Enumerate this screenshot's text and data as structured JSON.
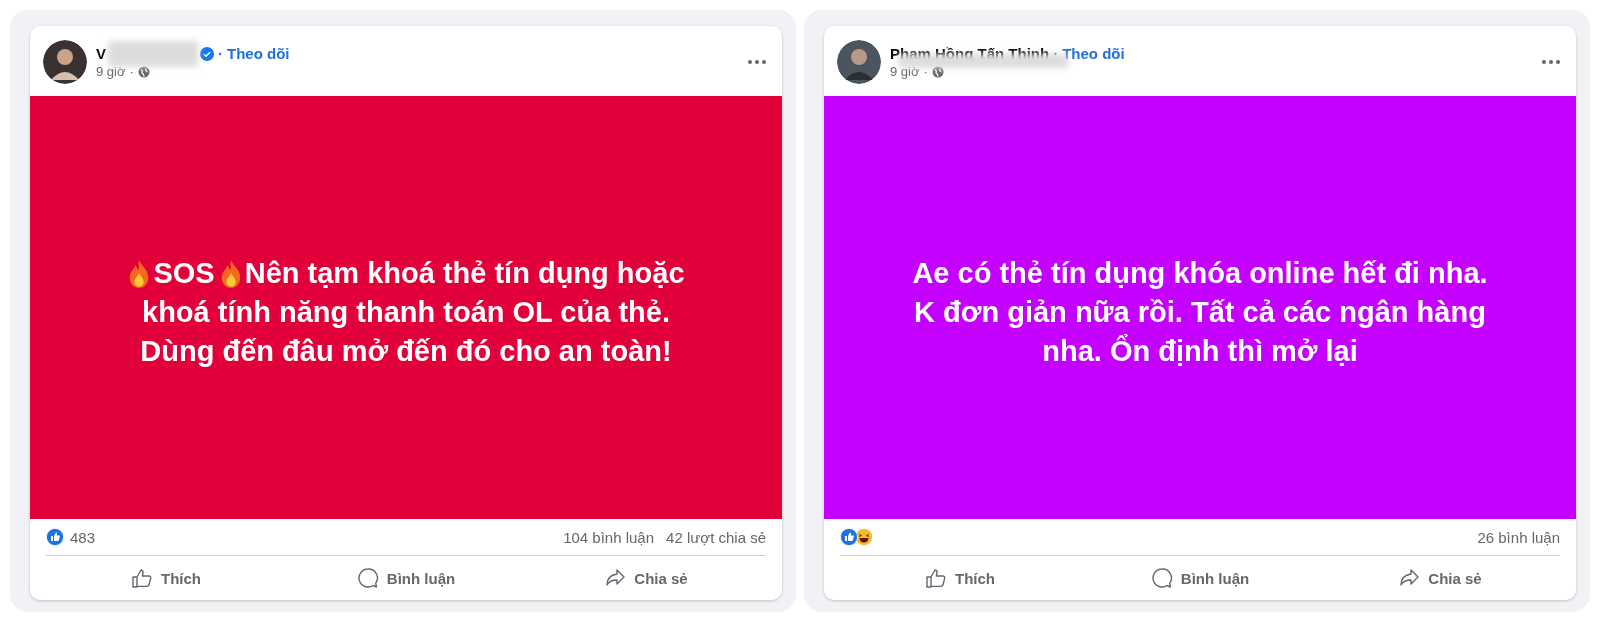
{
  "posts": [
    {
      "author": {
        "name": "V",
        "blurred": true,
        "verified": true
      },
      "separator": "·",
      "follow": "Theo dõi",
      "time": "9 giờ",
      "time_separator": "·",
      "color": "#e2003a",
      "lines": [
        [
          {
            "kind": "fire"
          },
          {
            "kind": "text",
            "text": "SOS"
          },
          {
            "kind": "fire"
          },
          {
            "kind": "text",
            "text": "Nên tạm khoá thẻ tín dụng hoặc"
          }
        ],
        [
          {
            "kind": "text",
            "text": "khoá tính năng thanh toán OL của thẻ."
          }
        ],
        [
          {
            "kind": "text",
            "text": "Dùng đến đâu mở đến đó cho an toàn!"
          }
        ]
      ],
      "reactions": [
        {
          "kind": "like"
        }
      ],
      "reaction_count": "483",
      "stats": [
        "104 bình luận",
        "42 lượt chia sẻ"
      ],
      "actions": [
        "Thích",
        "Bình luận",
        "Chia sẻ"
      ]
    },
    {
      "author": {
        "name": "Phạm Hồng Tấn Thịnh",
        "blurred": true,
        "verified": false
      },
      "separator": "·",
      "follow": "Theo dõi",
      "time": "9 giờ",
      "time_separator": "·",
      "color": "#c400ff",
      "lines": [
        [
          {
            "kind": "text",
            "text": "Ae có thẻ tín dụng khóa online hết đi nha."
          }
        ],
        [
          {
            "kind": "text",
            "text": "K đơn giản nữa rồi. Tất cả các ngân hàng"
          }
        ],
        [
          {
            "kind": "text",
            "text": "nha. Ổn định thì mở lại"
          }
        ]
      ],
      "reactions": [
        {
          "kind": "like"
        },
        {
          "kind": "haha"
        }
      ],
      "stats": [
        "26 bình luận"
      ],
      "actions": [
        "Thích",
        "Bình luận",
        "Chia sẻ"
      ]
    }
  ]
}
